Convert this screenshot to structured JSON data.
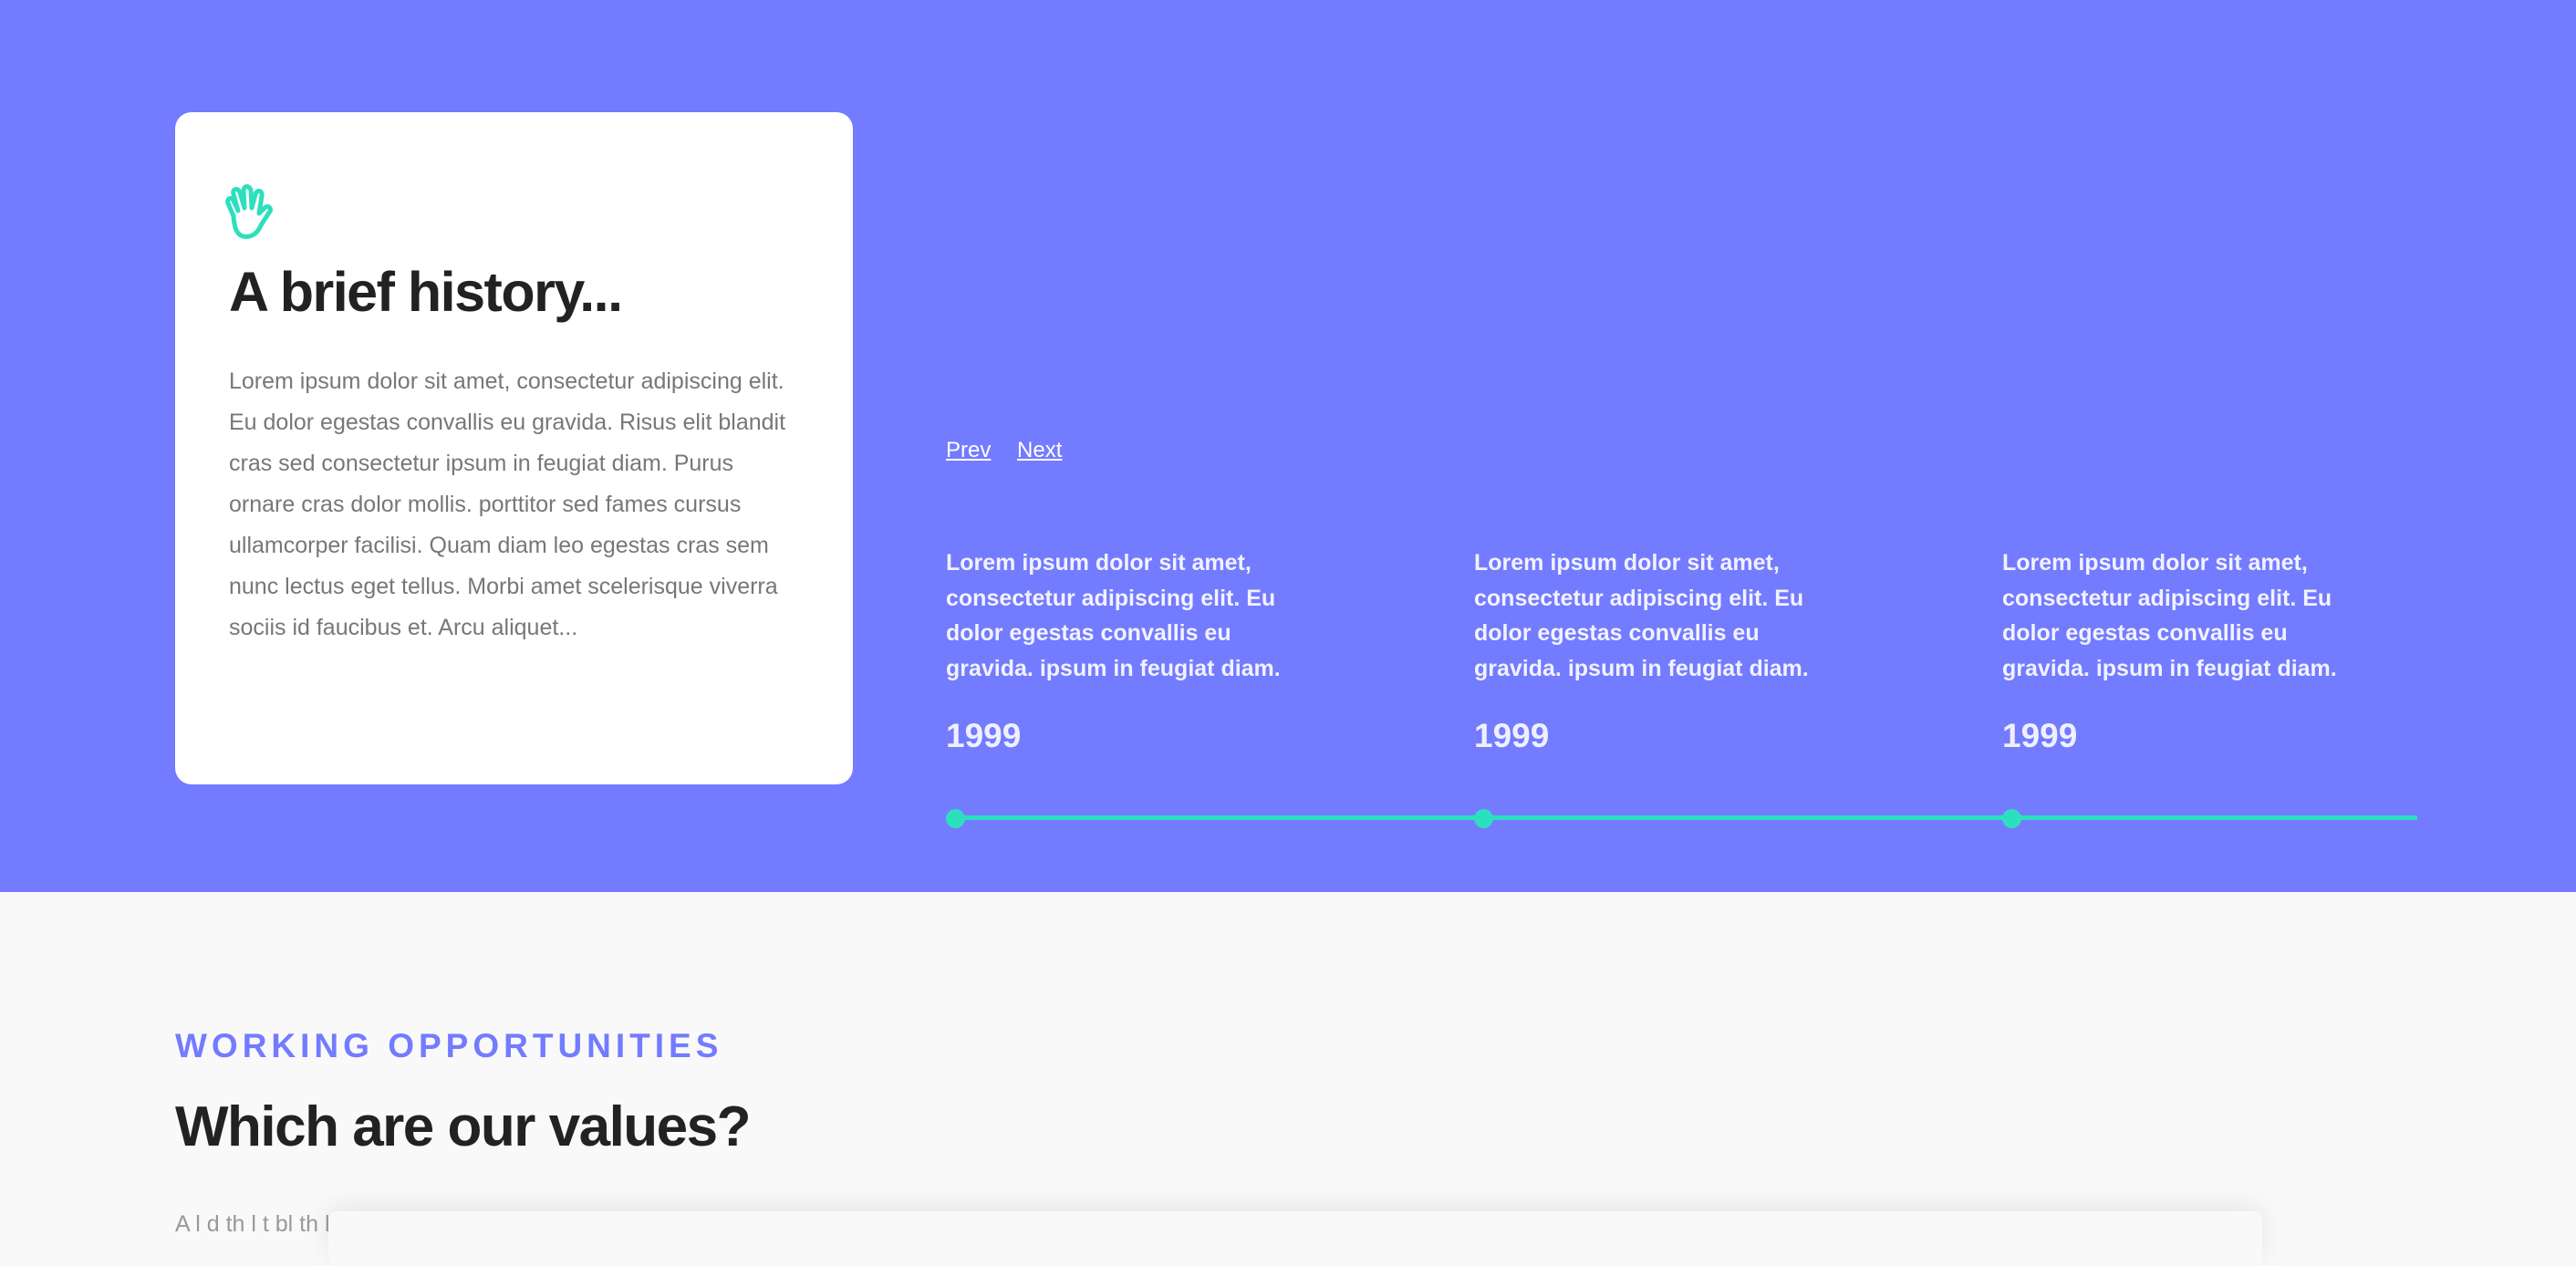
{
  "history": {
    "title": "A brief history...",
    "body": "Lorem ipsum dolor sit amet, consectetur adipiscing elit. Eu dolor egestas convallis eu gravida. Risus elit blandit cras sed consectetur ipsum in feugiat diam. Purus ornare cras dolor mollis. porttitor sed fames cursus ullamcorper facilisi. Quam diam leo egestas cras sem nunc lectus eget tellus. Morbi amet scelerisque viverra sociis id faucibus et. Arcu aliquet...",
    "icon": "hand-wave-icon"
  },
  "nav": {
    "prev": "Prev",
    "next": "Next"
  },
  "events": [
    {
      "text": "Lorem ipsum dolor sit amet, consectetur adipiscing elit. Eu dolor egestas convallis eu gravida. ipsum in feugiat diam.",
      "year": "1999"
    },
    {
      "text": "Lorem ipsum dolor sit amet, consectetur adipiscing elit. Eu dolor egestas convallis eu gravida. ipsum in feugiat diam.",
      "year": "1999"
    },
    {
      "text": "Lorem ipsum dolor sit amet, consectetur adipiscing elit. Eu dolor egestas convallis eu gravida. ipsum in feugiat diam.",
      "year": "1999"
    }
  ],
  "values": {
    "eyebrow": "WORKING OPPORTUNITIES",
    "title": "Which are our values?",
    "intro_partial": "A                    l  d  th     l    t      bl    th    l  th          t"
  },
  "colors": {
    "hero_bg": "#737bff",
    "accent": "#2de0bd",
    "page_bg": "#f9f9f9"
  }
}
